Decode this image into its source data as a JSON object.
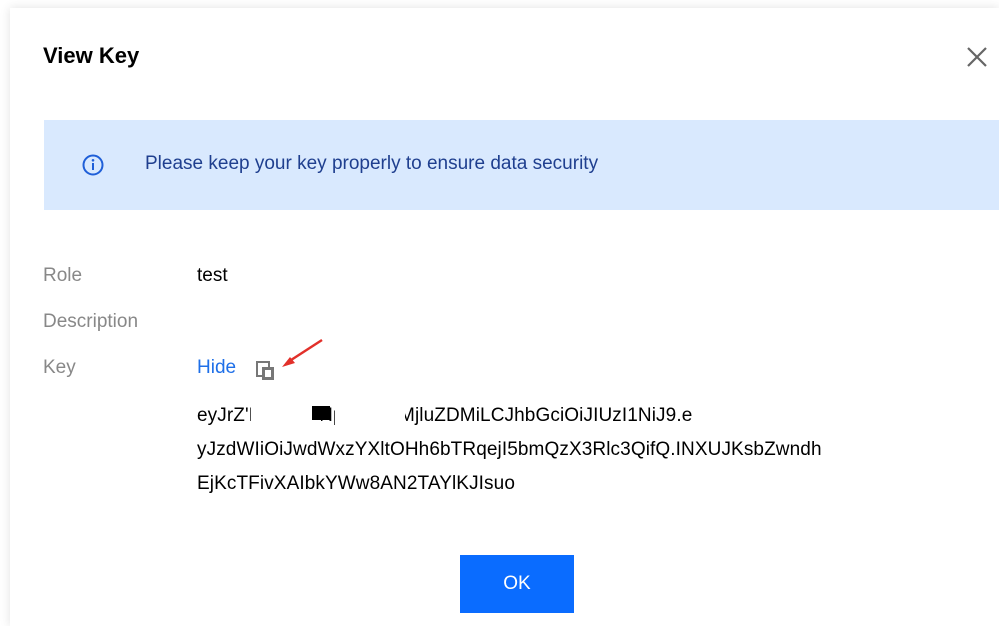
{
  "dialog": {
    "title": "View Key",
    "close_icon": "close-icon"
  },
  "notice": {
    "icon": "info-icon",
    "text": "Please keep your key properly to ensure data security",
    "background": "#d9e9fe",
    "text_color": "#1f3f8f"
  },
  "fields": {
    "role_label": "Role",
    "role_value": "test",
    "description_label": "Description",
    "description_value": "",
    "key_label": "Key",
    "hide_label": "Hide",
    "copy_icon": "copy-icon",
    "key_value_lines": [
      "eyJrZ'Nhci04eHptNGp6MjluZDMiLCJhbGciOiJIUzI1NiJ9.e",
      "yJzdWIiOiJwdWxzYXltOHh6bTRqejI5bmQzX3Rlc3QifQ.INXUJKsbZwndh",
      "EjKcTFivXAIbkYWw8AN2TAYlKJIsuo"
    ]
  },
  "footer": {
    "ok_label": "OK",
    "ok_color": "#0a6cff"
  },
  "annotation": {
    "arrow_color": "#e2302a"
  }
}
